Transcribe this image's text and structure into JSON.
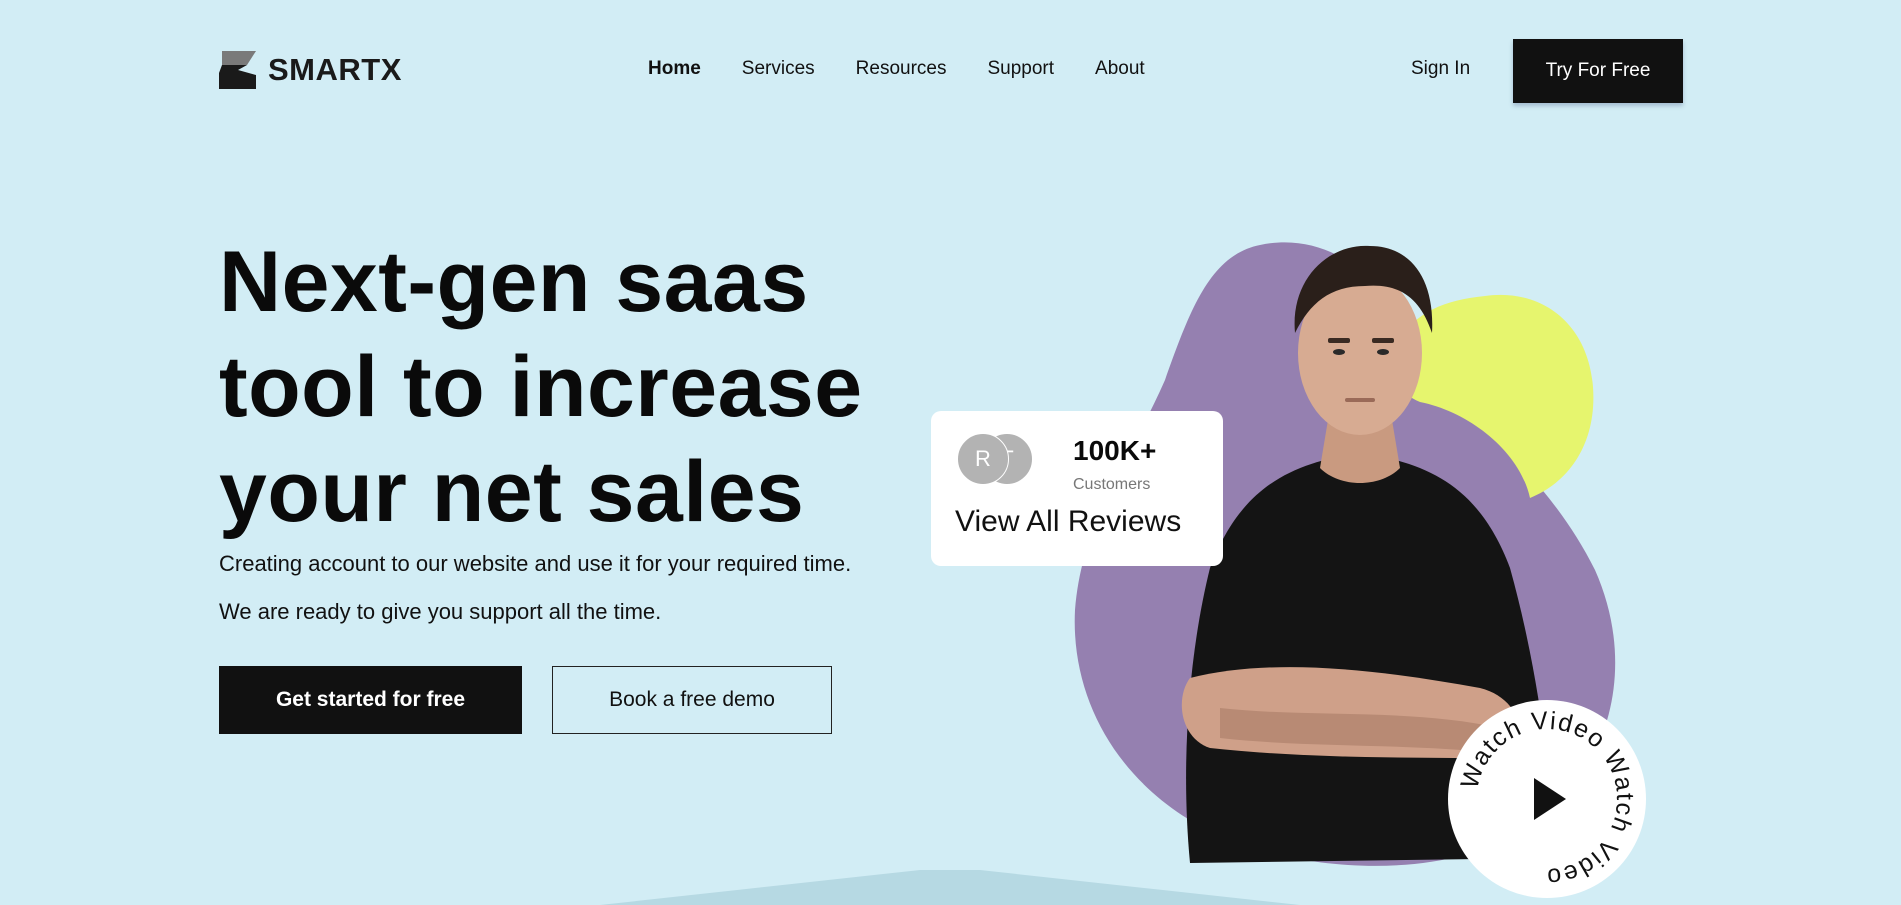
{
  "brand": {
    "name": "SMARTX",
    "icon": "logo-mark-icon"
  },
  "nav": {
    "items": [
      {
        "label": "Home",
        "active": true
      },
      {
        "label": "Services",
        "active": false
      },
      {
        "label": "Resources",
        "active": false
      },
      {
        "label": "Support",
        "active": false
      },
      {
        "label": "About",
        "active": false
      }
    ],
    "sign_in": "Sign In",
    "try_free": "Try For Free"
  },
  "hero": {
    "title": "Next-gen saas tool to increase your net sales",
    "subtitle_line1": "Creating account to our website and use it for your required time.",
    "subtitle_line2": "We are ready to give you support all the time.",
    "primary_cta": "Get started for free",
    "secondary_cta": "Book a free demo"
  },
  "reviews": {
    "avatars": [
      "R",
      "T"
    ],
    "count": "100K+",
    "count_label": "Customers",
    "link": "View All Reviews"
  },
  "video": {
    "circular_text": "Watch Video Watch Video",
    "icon": "play-icon"
  },
  "colors": {
    "background": "#d2edf5",
    "dark": "#111111",
    "purple_blob": "#9580b0",
    "yellow_blob": "#e6f56e",
    "card": "#ffffff"
  }
}
